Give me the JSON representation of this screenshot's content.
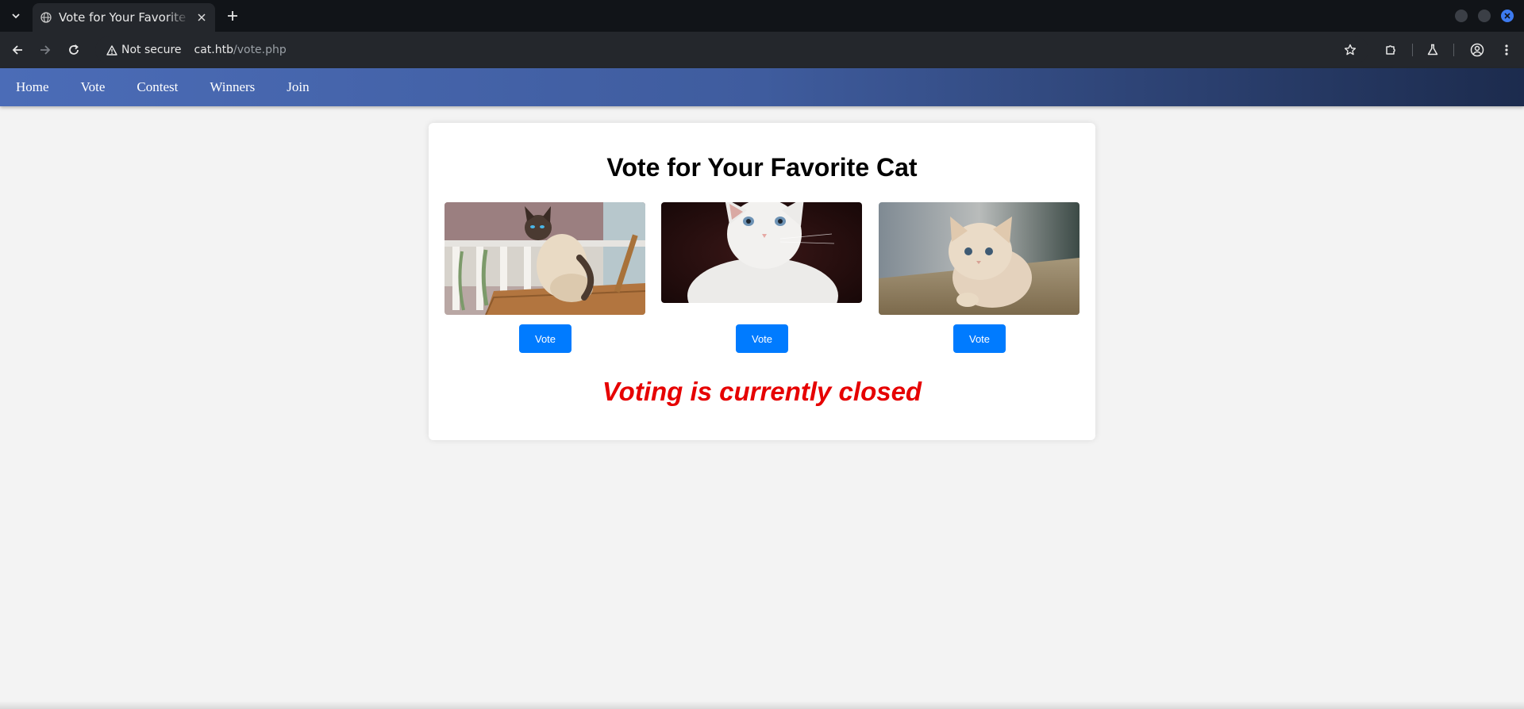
{
  "browser": {
    "tab_title": "Vote for Your Favorite Cat",
    "security_label": "Not secure",
    "url_host": "cat.htb",
    "url_path": "/vote.php"
  },
  "nav": {
    "items": [
      "Home",
      "Vote",
      "Contest",
      "Winners",
      "Join"
    ]
  },
  "page": {
    "title": "Vote for Your Favorite Cat",
    "cats": [
      {
        "button_label": "Vote",
        "photo": "siamese-cat-on-porch"
      },
      {
        "button_label": "Vote",
        "photo": "white-kitten-dark-background"
      },
      {
        "button_label": "Vote",
        "photo": "fluffy-cream-kitten"
      }
    ],
    "status_message": "Voting is currently closed"
  },
  "colors": {
    "nav_gradient_start": "#4b6cb7",
    "nav_gradient_end": "#1c2b4d",
    "vote_button": "#007bff",
    "closed_message": "#e60000"
  }
}
